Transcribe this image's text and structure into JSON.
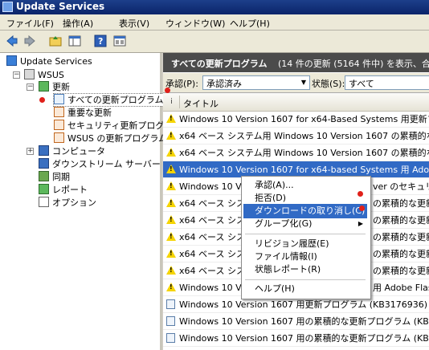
{
  "window": {
    "title": "Update Services"
  },
  "menubar": {
    "items": [
      "ファイル(F)",
      "操作(A)",
      "表示(V)",
      "ウィンドウ(W)",
      "ヘルプ(H)"
    ]
  },
  "toolbar": {
    "buttons": [
      "back-icon",
      "forward-icon",
      "up-folder-icon",
      "show-hide-tree-icon",
      "help-icon",
      "properties-icon"
    ]
  },
  "tree": {
    "root": "Update Services",
    "server": "WSUS",
    "updates": "更新",
    "all_updates": "すべての更新プログラム",
    "critical": "重要な更新",
    "security": "セキュリティ更新プログラ",
    "wsus_updates": "WSUS の更新プログラム",
    "computers": "コンピュータ",
    "downstream": "ダウンストリーム サーバー",
    "sync": "同期",
    "reports": "レポート",
    "options": "オプション"
  },
  "right": {
    "header_title": "すべての更新プログラム",
    "header_count": "(14 件の更新 (5164 件中) を表示、合",
    "approval_label": "承認(P):",
    "approval_value": "承認済み",
    "status_label": "状態(S):",
    "status_value": "すべて",
    "col_info": "i",
    "col_title": "タイトル"
  },
  "rows": [
    {
      "icon": "warning-icon",
      "title": "Windows 10 Version 1607 for x64-Based Systems 用更新プロ"
    },
    {
      "icon": "warning-icon",
      "title": "x64 ベース システム用 Windows 10 Version 1607 の累積的な更"
    },
    {
      "icon": "warning-icon",
      "title": "x64 ベース システム用 Windows 10 Version 1607 の累積的な更"
    },
    {
      "icon": "warning-icon",
      "title": "Windows 10 Version 1607 for x64-based Systems 用 Adobe"
    },
    {
      "icon": "warning-icon",
      "title": "Windows 10 Versi",
      "tail": "ver のセキュリテ"
    },
    {
      "icon": "warning-icon",
      "title": "x64 ベース シス",
      "tail": "の累積的な更新"
    },
    {
      "icon": "warning-icon",
      "title": "x64 ベース シス",
      "tail": "の累積的な更新"
    },
    {
      "icon": "warning-icon",
      "title": "x64 ベース シス",
      "tail": "の累積的な更新"
    },
    {
      "icon": "warning-icon",
      "title": "x64 ベース シス",
      "tail": "の累積的な更新"
    },
    {
      "icon": "warning-icon",
      "title": "x64 ベース シス",
      "tail": "の累積的な更新"
    },
    {
      "icon": "warning-icon",
      "title": "Windows 10 Versi",
      "tail": "用更新プログラ"
    },
    {
      "icon": "warning-icon",
      "title": "Windows 10 Versi",
      "tail": "用 Adobe Flash"
    },
    {
      "icon": "document-icon",
      "title": "Windows 10 Version 1607 用更新プログラム (KB3176936)"
    },
    {
      "icon": "document-icon",
      "title": "Windows 10 Version 1607 用の累積的な更新プログラム (KB319"
    },
    {
      "icon": "document-icon",
      "title": "Windows 10 Version 1607 用の累積的な更新プログラム (KB319"
    }
  ],
  "context_menu": {
    "items": [
      "承認(A)...",
      "拒否(D)",
      "ダウンロードの取り消し(C)",
      "グループ化(G)",
      "リビジョン履歴(E)",
      "ファイル情報(I)",
      "状態レポート(R)",
      "ヘルプ(H)"
    ],
    "highlighted": "ダウンロードの取り消し(C)"
  },
  "colors": {
    "selection": "#316ac5",
    "header_bg": "#4b4b4b",
    "annotation_dot": "#e0201a"
  }
}
